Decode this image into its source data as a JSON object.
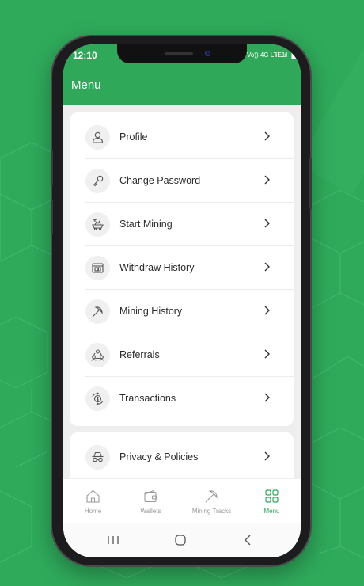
{
  "status_bar": {
    "time": "12:10",
    "network": "Vo)) 4G LTE1",
    "signal": "..ıl ..ıl"
  },
  "app_bar": {
    "title": "Menu"
  },
  "menu": {
    "items": [
      {
        "label": "Profile",
        "icon": "profile-icon"
      },
      {
        "label": "Change Password",
        "icon": "key-icon"
      },
      {
        "label": "Start Mining",
        "icon": "mining-cart-icon"
      },
      {
        "label": "Withdraw History",
        "icon": "withdraw-icon"
      },
      {
        "label": "Mining History",
        "icon": "pickaxe-icon"
      },
      {
        "label": "Referrals",
        "icon": "referrals-icon"
      },
      {
        "label": "Transactions",
        "icon": "transactions-icon"
      }
    ],
    "secondary_items": [
      {
        "label": "Privacy & Policies",
        "icon": "incognito-icon"
      }
    ]
  },
  "bottom_nav": {
    "items": [
      {
        "label": "Home",
        "icon": "home-icon",
        "active": false
      },
      {
        "label": "Wallets",
        "icon": "wallet-icon",
        "active": false
      },
      {
        "label": "Mining Tracks",
        "icon": "pickaxe-icon",
        "active": false
      },
      {
        "label": "Menu",
        "icon": "grid-icon",
        "active": true
      }
    ]
  },
  "colors": {
    "accent": "#2fa85a",
    "background": "#2faa5b"
  }
}
